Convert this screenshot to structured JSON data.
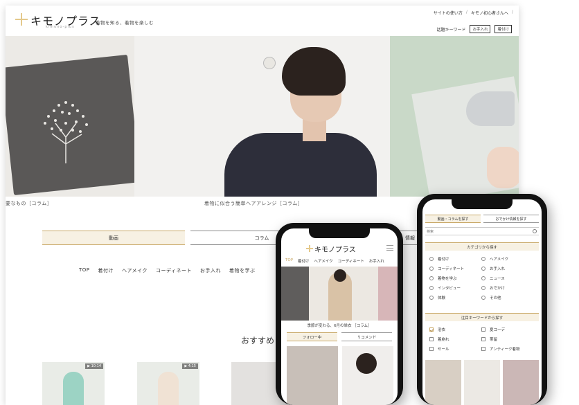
{
  "desktop": {
    "logo": "キモノプラス",
    "logo_sub": "kimono-plus",
    "tagline": "着物を知る、着物を楽しむ",
    "toplinks": [
      "サイトの使い方",
      "キモノ初心者さんへ"
    ],
    "keyword_label": "話題キーワード",
    "keywords": [
      "お手入れ",
      "着付け"
    ],
    "hero_captions": [
      "要なもの［コラム］",
      "着物に似合う簡単ヘアアレンジ［コラム］"
    ],
    "tabs": [
      {
        "label": "動画",
        "active": true
      },
      {
        "label": "コラム",
        "active": false
      },
      {
        "label": "情報",
        "active": false
      }
    ],
    "nav": [
      "TOP",
      "着付け",
      "ヘアメイク",
      "コーディネート",
      "お手入れ",
      "着物を学ぶ"
    ],
    "recommend_title": "おすすめ",
    "video_badges": [
      "▶ 10:14",
      "▶ 4:15"
    ]
  },
  "phone_front": {
    "logo": "キモノプラス",
    "nav": [
      "TOP",
      "着付け",
      "ヘアメイク",
      "コーディネート",
      "お手入れ"
    ],
    "caption": "季節が変わる、6月の単衣 ［コラム］",
    "tabs": [
      {
        "label": "フォロー中",
        "active": true
      },
      {
        "label": "リコメンド",
        "active": false
      }
    ]
  },
  "phone_back": {
    "tabs": [
      {
        "label": "動画・コラムを探す",
        "active": true
      },
      {
        "label": "おでかけ情報を探す",
        "active": false
      }
    ],
    "search_placeholder": "検索",
    "category_heading": "カテゴリから探す",
    "categories": [
      "着付け",
      "ヘアメイク",
      "コーディネート",
      "お手入れ",
      "着物を学ぶ",
      "ニュース",
      "インタビュー",
      "おでかけ",
      "体験",
      "その他"
    ],
    "keyword_heading": "注目キーワードから探す",
    "keywords": [
      {
        "label": "浴衣",
        "checked": true
      },
      {
        "label": "夏コーデ",
        "checked": false
      },
      {
        "label": "着崩れ",
        "checked": false
      },
      {
        "label": "帯留",
        "checked": false
      },
      {
        "label": "セール",
        "checked": false
      },
      {
        "label": "アンティーク着物",
        "checked": false
      }
    ]
  },
  "colors": {
    "accent_gold": "#c9a968",
    "tab_active_bg": "#f7f1e3",
    "text": "#333333"
  }
}
